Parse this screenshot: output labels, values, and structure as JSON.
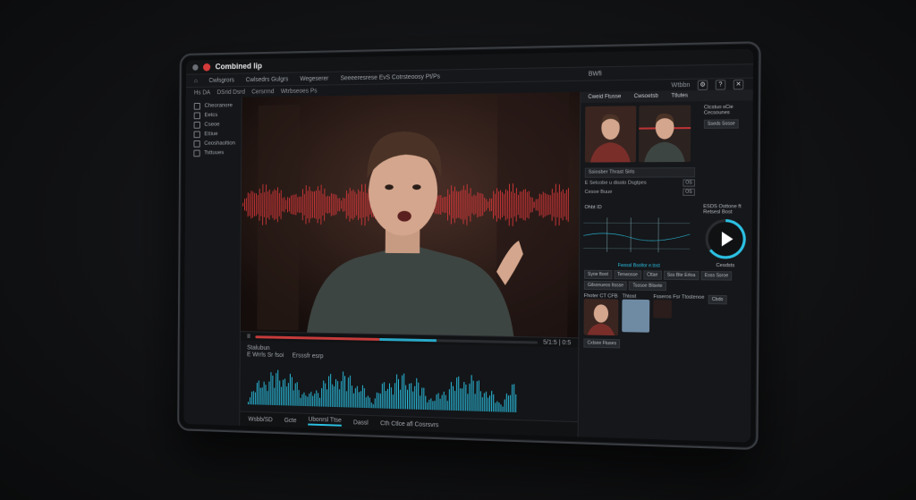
{
  "window": {
    "title": "Combined lip"
  },
  "menu": {
    "items": [
      "Cwlsgrors",
      "Cwlsedrs Gulgrs",
      "Wegeserer",
      "Seeeeresrese EvS Cotrsteoosy Pt/Ps"
    ],
    "center_label": "BWfi"
  },
  "toolbar": {
    "left": [
      "Hs DA",
      "DSrid Dsrd",
      "Cersrrnd",
      "Wtrbseoes Ps"
    ],
    "right_label": "Wtbbn"
  },
  "sidebar": {
    "items": [
      {
        "label": "Cheoranore",
        "icon": "grid-icon"
      },
      {
        "label": "Eetcs",
        "icon": "link-icon"
      },
      {
        "label": "Cseoe",
        "icon": "copy-icon"
      },
      {
        "label": "Ettiue",
        "icon": "folder-icon"
      },
      {
        "label": "Ceoshaoltion",
        "icon": "camera-icon"
      },
      {
        "label": "Tsttuues",
        "icon": "film-icon"
      }
    ]
  },
  "player": {
    "time": "5/1:5 | 0:5",
    "scrub_red_pct": 45,
    "scrub_blue_pct": 20
  },
  "timeline": {
    "header": "Stalubun",
    "track_labels": [
      "E Wrrls Sr fsoi",
      "Ersssfr esrp"
    ],
    "play_label": "II"
  },
  "bottombar": {
    "items": [
      "Wsbb/SD",
      "Gcte",
      "Ubonrsl Ttse",
      "Dassl",
      "Cth Ctlce afl Cosrsvrs"
    ],
    "active_index": 2
  },
  "right_panel": {
    "tabs": [
      "Cweid Ftusse",
      "Cwsoetsb",
      "Ttlutes"
    ],
    "side_label": "Ctcstuo sCie Cecsounes",
    "side_button": "Sseds Sosse",
    "field1": "Ssiosber Thrast Sirls",
    "row1_label": "E Setcobe u dissto Dsgtpes",
    "row1_chip": "OS",
    "row2_label": "Cesoe Buue",
    "row2_chip": "OS",
    "chart_label": "Ohbt ID",
    "gauge_label": "ESDS Osttone ft Retsesl Bost",
    "gauge_caption": "Cesdsts",
    "chart_btn": "Fwsssl Bsoltor e.tost",
    "grid_buttons": [
      "Syoe ftoot",
      "Tenwosse",
      "Cttae",
      "Sss Bte Erloa",
      "Esss Ssroe"
    ],
    "grid_buttons2": [
      "Gilsonueos Itssse",
      "Tsosoe Blisete"
    ],
    "section_label": "Fhoter CT CFB",
    "thumb2_label": "Thtost",
    "thumb3_label": "Fsseros Fsr Ttostenoe",
    "side_button2": "Cbdo",
    "footer_button": "Cxtsee Ftuses"
  },
  "colors": {
    "accent": "#2bc1e3",
    "red": "#e0393b"
  }
}
